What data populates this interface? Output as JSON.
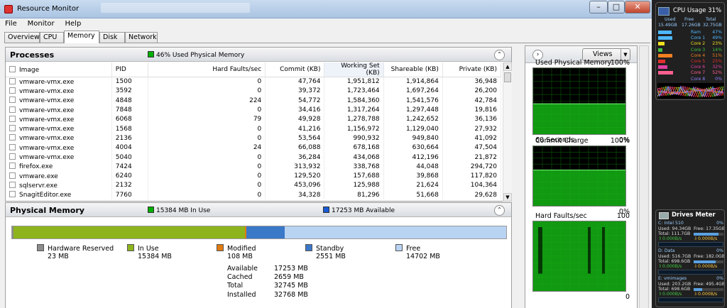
{
  "window": {
    "title": "Resource Monitor",
    "btn_min": "–",
    "btn_max": "□",
    "btn_close": "✕"
  },
  "menu": [
    "File",
    "Monitor",
    "Help"
  ],
  "tabs": [
    "Overview",
    "CPU",
    "Memory",
    "Disk",
    "Network"
  ],
  "active_tab": "Memory",
  "processes": {
    "title": "Processes",
    "status": "46% Used Physical Memory",
    "status_color": "#00b000",
    "columns": [
      "Image",
      "PID",
      "Hard Faults/sec",
      "Commit (KB)",
      "Working Set (KB)",
      "Shareable (KB)",
      "Private (KB)"
    ],
    "rows": [
      [
        "vmware-vmx.exe",
        "1500",
        "0",
        "47,764",
        "1,951,812",
        "1,914,864",
        "36,948"
      ],
      [
        "vmware-vmx.exe",
        "3592",
        "0",
        "39,372",
        "1,723,464",
        "1,697,264",
        "26,200"
      ],
      [
        "vmware-vmx.exe",
        "4848",
        "224",
        "54,772",
        "1,584,360",
        "1,541,576",
        "42,784"
      ],
      [
        "vmware-vmx.exe",
        "7848",
        "0",
        "34,416",
        "1,317,264",
        "1,297,448",
        "19,816"
      ],
      [
        "vmware-vmx.exe",
        "6068",
        "79",
        "49,928",
        "1,278,788",
        "1,242,652",
        "36,136"
      ],
      [
        "vmware-vmx.exe",
        "1568",
        "0",
        "41,216",
        "1,156,972",
        "1,129,040",
        "27,932"
      ],
      [
        "vmware-vmx.exe",
        "2136",
        "0",
        "53,564",
        "990,932",
        "949,840",
        "41,092"
      ],
      [
        "vmware-vmx.exe",
        "4004",
        "24",
        "66,088",
        "678,168",
        "630,664",
        "47,504"
      ],
      [
        "vmware-vmx.exe",
        "5040",
        "0",
        "36,284",
        "434,068",
        "412,196",
        "21,872"
      ],
      [
        "firefox.exe",
        "7424",
        "0",
        "313,932",
        "338,768",
        "44,048",
        "294,720"
      ],
      [
        "vmware.exe",
        "6240",
        "0",
        "129,520",
        "157,688",
        "39,868",
        "117,820"
      ],
      [
        "sqlservr.exe",
        "2132",
        "0",
        "453,096",
        "125,988",
        "21,624",
        "104,364"
      ],
      [
        "SnagitEditor.exe",
        "7760",
        "0",
        "34,328",
        "81,296",
        "51,668",
        "29,628"
      ]
    ]
  },
  "physical_memory": {
    "title": "Physical Memory",
    "in_use_label": "15384 MB In Use",
    "in_use_color": "#00b000",
    "available_label": "17253 MB Available",
    "available_color": "#1a5bd6",
    "bar": [
      {
        "name": "Hardware Reserved",
        "mb": 23,
        "color": "#8c8c8c"
      },
      {
        "name": "In Use",
        "mb": 15384,
        "color": "#8db41c"
      },
      {
        "name": "Modified",
        "mb": 108,
        "color": "#e07b12"
      },
      {
        "name": "Standby",
        "mb": 2551,
        "color": "#3a78c8"
      },
      {
        "name": "Free",
        "mb": 14702,
        "color": "#b9d3f2"
      }
    ],
    "legend": [
      {
        "name": "Hardware Reserved",
        "value": "23 MB",
        "color": "#8c8c8c"
      },
      {
        "name": "In Use",
        "value": "15384 MB",
        "color": "#8db41c"
      },
      {
        "name": "Modified",
        "value": "108 MB",
        "color": "#e07b12"
      },
      {
        "name": "Standby",
        "value": "2551 MB",
        "color": "#3a78c8"
      },
      {
        "name": "Free",
        "value": "14702 MB",
        "color": "#b9d3f2"
      }
    ],
    "summary": [
      [
        "Available",
        "17253 MB"
      ],
      [
        "Cached",
        "2659 MB"
      ],
      [
        "Total",
        "32745 MB"
      ],
      [
        "Installed",
        "32768 MB"
      ]
    ]
  },
  "right_panel": {
    "expand_icon": "chevron-right-icon",
    "views_label": "Views",
    "graphs": [
      {
        "title": "Used Physical Memory",
        "max": "100%",
        "bottom_left": "60 Seconds",
        "bottom_right": "0%",
        "level": 0.46,
        "kind": "steady"
      },
      {
        "title": "Commit Charge",
        "max": "100%",
        "bottom_left": "",
        "bottom_right": "0%",
        "level": 0.6,
        "kind": "steady"
      },
      {
        "title": "Hard Faults/sec",
        "max": "100",
        "bottom_left": "",
        "bottom_right": "0",
        "level": 1.0,
        "kind": "faults"
      }
    ]
  },
  "cpu_gadget": {
    "title": "CPU Usage",
    "percent": "31%",
    "cols": [
      "Used",
      "Free",
      "Total"
    ],
    "vals": [
      "15.49GB",
      "17.26GB",
      "32.75GB"
    ],
    "ram_label": "Ram",
    "ram_value": "47%",
    "cores": [
      {
        "label": "Core 1",
        "value": "49%",
        "color": "#4db8ff"
      },
      {
        "label": "Core 2",
        "value": "23%",
        "color": "#f0e020"
      },
      {
        "label": "Core 3",
        "value": "14%",
        "color": "#40c040"
      },
      {
        "label": "Core 4",
        "value": "51%",
        "color": "#f08020"
      },
      {
        "label": "Core 5",
        "value": "25%",
        "color": "#e03030"
      },
      {
        "label": "Core 6",
        "value": "32%",
        "color": "#e040a0"
      },
      {
        "label": "Core 7",
        "value": "52%",
        "color": "#ff6090"
      },
      {
        "label": "Core 8",
        "value": "0%",
        "color": "#9080ff"
      }
    ]
  },
  "drives_gadget": {
    "title": "Drives Meter",
    "drives": [
      {
        "name": "C: Intel 510",
        "pct": "0%",
        "used": "Used: 94.34GB",
        "free": "Free: 17.35GB",
        "total": "Total: 111.7GB",
        "read": "0.000B/s",
        "write": "0.000B/s",
        "fill": 0.84
      },
      {
        "name": "D: Data",
        "pct": "0%",
        "used": "Used: 516.7GB",
        "free": "Free: 182.0GB",
        "total": "Total: 698.6GB",
        "read": "0.000B/s",
        "write": "0.000B/s",
        "fill": 0.74
      },
      {
        "name": "E: vmimages",
        "pct": "0%",
        "used": "Used: 203.2GB",
        "free": "Free: 495.4GB",
        "total": "Total: 698.6GB",
        "read": "0.000B/s",
        "write": "0.000B/s",
        "fill": 0.29
      }
    ]
  }
}
